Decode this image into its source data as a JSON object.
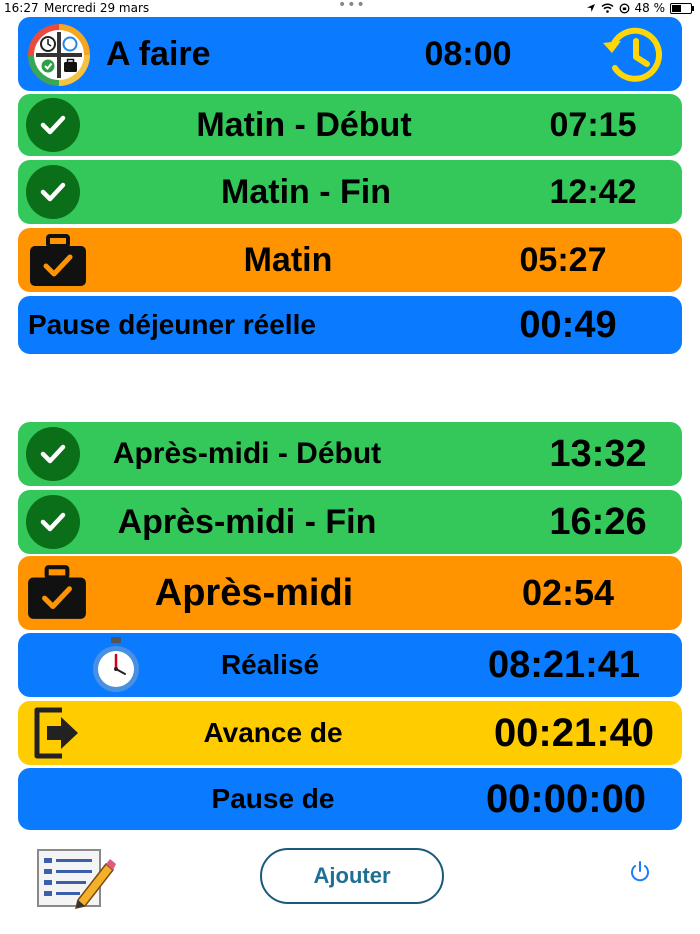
{
  "status_bar": {
    "time": "16:27",
    "date": "Mercredi 29 mars",
    "battery": "48 %"
  },
  "header": {
    "title": "A faire",
    "value": "08:00"
  },
  "rows": [
    {
      "label": "Matin - Début",
      "value": "07:15"
    },
    {
      "label": "Matin - Fin",
      "value": "12:42"
    },
    {
      "label": "Matin",
      "value": "05:27"
    },
    {
      "label": "Pause déjeuner réelle",
      "value": "00:49"
    },
    {
      "label": "Après-midi - Début",
      "value": "13:32"
    },
    {
      "label": "Après-midi - Fin",
      "value": "16:26"
    },
    {
      "label": "Après-midi",
      "value": "02:54"
    },
    {
      "label": "Réalisé",
      "value": "08:21:41"
    },
    {
      "label": "Avance de",
      "value": "00:21:40"
    },
    {
      "label": "Pause de",
      "value": "00:00:00"
    }
  ],
  "bottom": {
    "add_label": "Ajouter"
  },
  "colors": {
    "blue": "#0a7bff",
    "green": "#34c759",
    "orange": "#ff9400",
    "yellow": "#ffcc00",
    "check_dark": "#0b6e18"
  },
  "icons": [
    "app-logo-icon",
    "history-clock-icon",
    "check-circle-icon",
    "briefcase-check-icon",
    "stopwatch-icon",
    "exit-arrow-icon",
    "list-edit-icon",
    "power-icon"
  ]
}
